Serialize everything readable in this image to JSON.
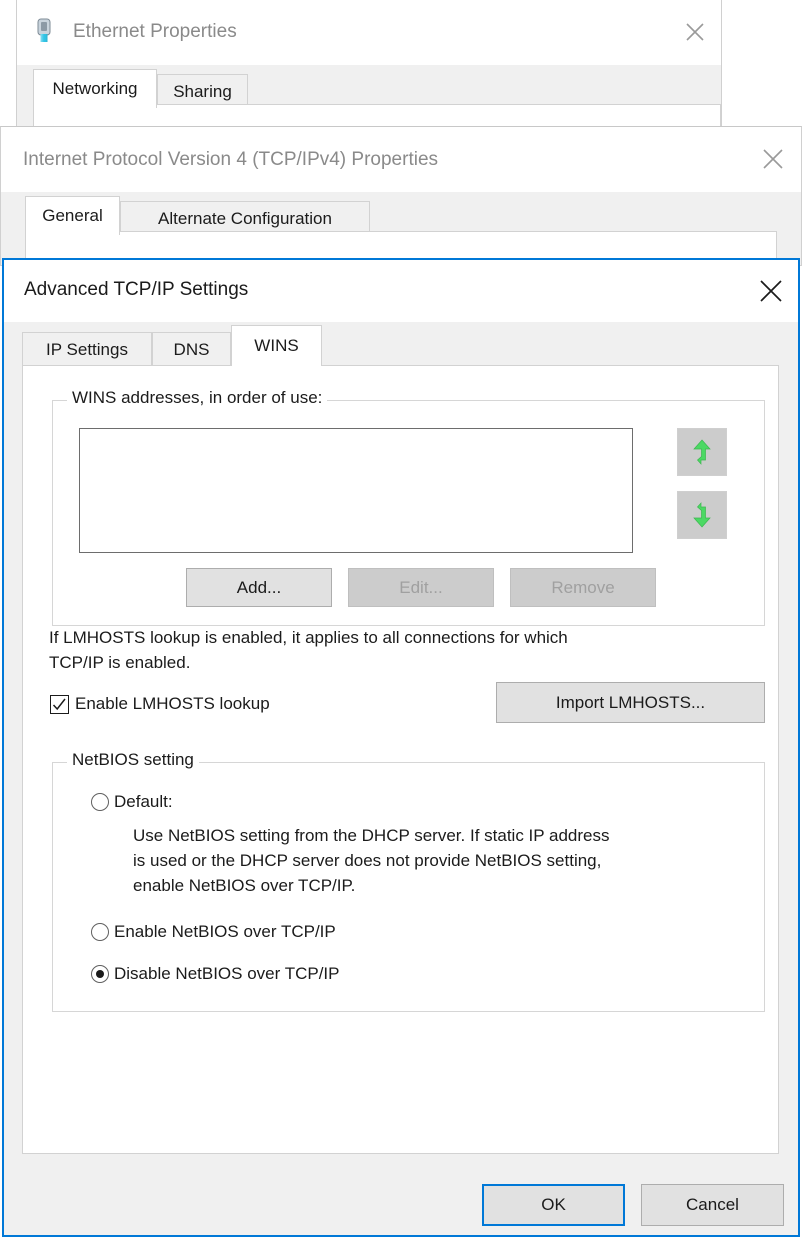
{
  "windows": {
    "ethernet_properties": {
      "title": "Ethernet Properties",
      "icon": "ethernet-plug-icon",
      "close_icon": "close-icon",
      "tabs": [
        {
          "label": "Networking",
          "active": true
        },
        {
          "label": "Sharing",
          "active": false
        }
      ]
    },
    "ipv4_properties": {
      "title": "Internet Protocol Version 4 (TCP/IPv4) Properties",
      "close_icon": "close-icon",
      "tabs": [
        {
          "label": "General",
          "active": true
        },
        {
          "label": "Alternate Configuration",
          "active": false
        }
      ]
    },
    "advanced_tcpip": {
      "title": "Advanced TCP/IP Settings",
      "close_icon": "close-icon",
      "active": true,
      "tabs": [
        {
          "label": "IP Settings",
          "active": false
        },
        {
          "label": "DNS",
          "active": false
        },
        {
          "label": "WINS",
          "active": true
        }
      ],
      "wins_group": {
        "legend": "WINS addresses, in order of use:",
        "list_items": [],
        "move_up_icon": "arrow-up-icon",
        "move_down_icon": "arrow-down-icon",
        "buttons": [
          {
            "label": "Add...",
            "enabled": true
          },
          {
            "label": "Edit...",
            "enabled": false
          },
          {
            "label": "Remove",
            "enabled": false
          }
        ]
      },
      "lmhosts": {
        "description_line1": "If LMHOSTS lookup is enabled, it applies to all connections for which",
        "description_line2": "TCP/IP is enabled.",
        "checkbox_label": "Enable LMHOSTS lookup",
        "checkbox_checked": true,
        "import_button": "Import LMHOSTS..."
      },
      "netbios_group": {
        "legend": "NetBIOS setting",
        "options": [
          {
            "label": "Default:",
            "selected": false,
            "help_line1": "Use NetBIOS setting from the DHCP server. If static IP address",
            "help_line2": "is used or the DHCP server does not provide NetBIOS setting,",
            "help_line3": "enable NetBIOS over TCP/IP."
          },
          {
            "label": "Enable NetBIOS over TCP/IP",
            "selected": false
          },
          {
            "label": "Disable NetBIOS over TCP/IP",
            "selected": true
          }
        ]
      },
      "footer_buttons": [
        {
          "label": "OK",
          "default": true
        },
        {
          "label": "Cancel",
          "default": false
        }
      ]
    }
  },
  "colors": {
    "accent": "#0078d7",
    "arrow_green": "#4cd964",
    "dialog_bg": "#f0f0f0",
    "panel_bg": "#ffffff",
    "disabled_text": "#a0a0a0"
  }
}
